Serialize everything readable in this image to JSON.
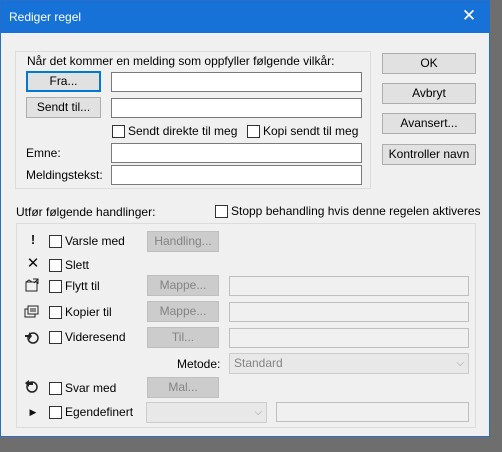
{
  "dialog": {
    "title": "Rediger regel",
    "close_glyph": "✕"
  },
  "conditions": {
    "heading": "Når det kommer en melding som oppfyller følgende vilkår:",
    "from_button": "Fra...",
    "sent_to_button": "Sendt til...",
    "sent_direct_label": "Sendt direkte til meg",
    "cc_label": "Kopi sendt til meg",
    "subject_label": "Emne:",
    "body_label": "Meldingstekst:"
  },
  "side_buttons": {
    "ok": "OK",
    "cancel": "Avbryt",
    "advanced": "Avansert...",
    "check_names": "Kontroller navn"
  },
  "actions": {
    "heading": "Utfør følgende handlinger:",
    "stop_processing": "Stopp behandling hvis denne regelen aktiveres",
    "notify_label": "Varsle med",
    "notify_button": "Handling...",
    "delete_label": "Slett",
    "move_label": "Flytt til",
    "move_button": "Mappe...",
    "copy_label": "Kopier til",
    "copy_button": "Mappe...",
    "forward_label": "Videresend",
    "forward_button": "Til...",
    "method_label": "Metode:",
    "method_value": "Standard",
    "reply_label": "Svar med",
    "reply_button": "Mal...",
    "custom_label": "Egendefinert"
  },
  "icons": {
    "notify": "exclamation-icon",
    "delete": "delete-x-icon",
    "move": "move-to-folder-icon",
    "copy": "copy-to-folder-icon",
    "forward": "forward-icon",
    "reply": "reply-icon",
    "custom": "expand-triangle-icon"
  }
}
